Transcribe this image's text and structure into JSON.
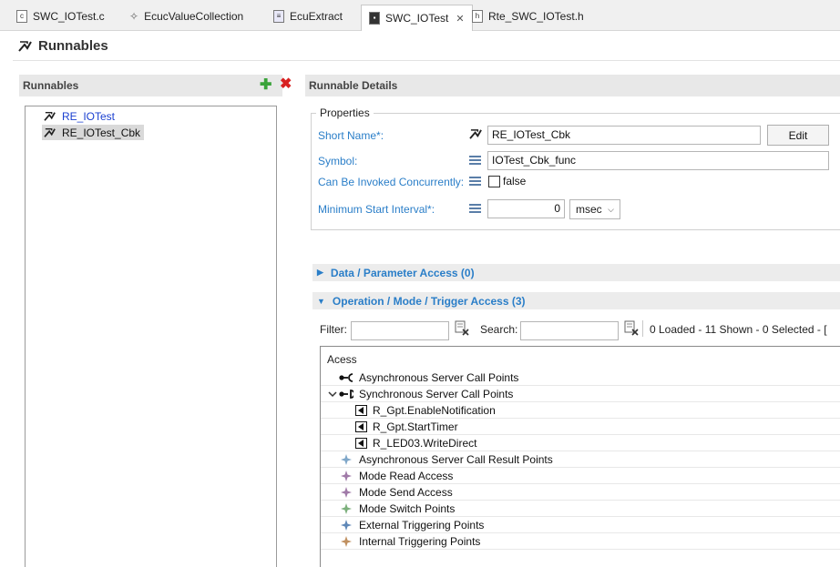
{
  "tabs": [
    {
      "label": "SWC_IOTest.c",
      "icon": "c-file-icon"
    },
    {
      "label": "EcucValueCollection",
      "icon": "ecuc-collection-icon"
    },
    {
      "label": "EcuExtract",
      "icon": "ecu-extract-icon"
    },
    {
      "label": "SWC_IOTest",
      "icon": "swc-icon",
      "active": true
    },
    {
      "label": "Rte_SWC_IOTest.h",
      "icon": "h-file-icon"
    }
  ],
  "page_title": "Runnables",
  "left_panel": {
    "title": "Runnables",
    "items": [
      "RE_IOTest",
      "RE_IOTest_Cbk"
    ],
    "selected": "RE_IOTest_Cbk"
  },
  "details": {
    "title": "Runnable Details",
    "group_label": "Properties",
    "short_name_label": "Short Name*:",
    "short_name_value": "RE_IOTest_Cbk",
    "edit_label": "Edit",
    "symbol_label": "Symbol:",
    "symbol_value": "IOTest_Cbk_func",
    "concurrent_label": "Can Be Invoked Concurrently:",
    "concurrent_value": "false",
    "interval_label": "Minimum Start Interval*:",
    "interval_value": "0",
    "interval_unit": "msec"
  },
  "sections": {
    "data_access": "Data / Parameter Access (0)",
    "operation_access": "Operation / Mode / Trigger Access (3)"
  },
  "filter": {
    "filter_label": "Filter:",
    "search_label": "Search:",
    "status": "0 Loaded - 11 Shown - 0 Selected -  ["
  },
  "table": {
    "header": "Acess",
    "rows": [
      {
        "label": "Asynchronous Server Call Points",
        "icon": "async-call-icon",
        "level": 0
      },
      {
        "label": "Synchronous Server Call Points",
        "icon": "sync-call-icon",
        "level": 0,
        "expanded": true
      },
      {
        "label": "R_Gpt.EnableNotification",
        "icon": "port-operation-icon",
        "level": 1
      },
      {
        "label": "R_Gpt.StartTimer",
        "icon": "port-operation-icon",
        "level": 1
      },
      {
        "label": "R_LED03.WriteDirect",
        "icon": "port-operation-icon",
        "level": 1
      },
      {
        "label": "Asynchronous Server Call Result Points",
        "icon": "async-result-icon",
        "level": 0
      },
      {
        "label": "Mode Read Access",
        "icon": "mode-read-icon",
        "level": 0
      },
      {
        "label": "Mode Send Access",
        "icon": "mode-send-icon",
        "level": 0
      },
      {
        "label": "Mode Switch Points",
        "icon": "mode-switch-icon",
        "level": 0
      },
      {
        "label": "External Triggering Points",
        "icon": "external-trigger-icon",
        "level": 0
      },
      {
        "label": "Internal Triggering Points",
        "icon": "internal-trigger-icon",
        "level": 0
      }
    ]
  },
  "colors": {
    "link_blue": "#2a7ec8",
    "item_blue": "#1a3fd0",
    "add_green": "#3aa33a",
    "delete_red": "#d82020"
  }
}
